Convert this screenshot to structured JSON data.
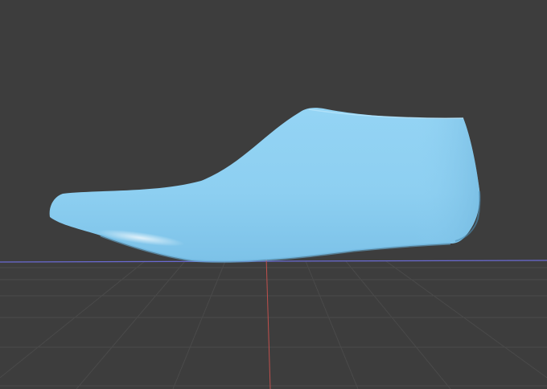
{
  "viewport": {
    "background_color": "#3d3d3d",
    "grid_line_color": "#4a4a4a",
    "x_axis_color": "#6f6fd0",
    "y_axis_color": "#c0504d"
  },
  "model": {
    "name": "shoe-last",
    "base_color": "#8fd0f2",
    "highlight_color": "#c9ecfb",
    "shadow_color": "#5fa8cf"
  }
}
